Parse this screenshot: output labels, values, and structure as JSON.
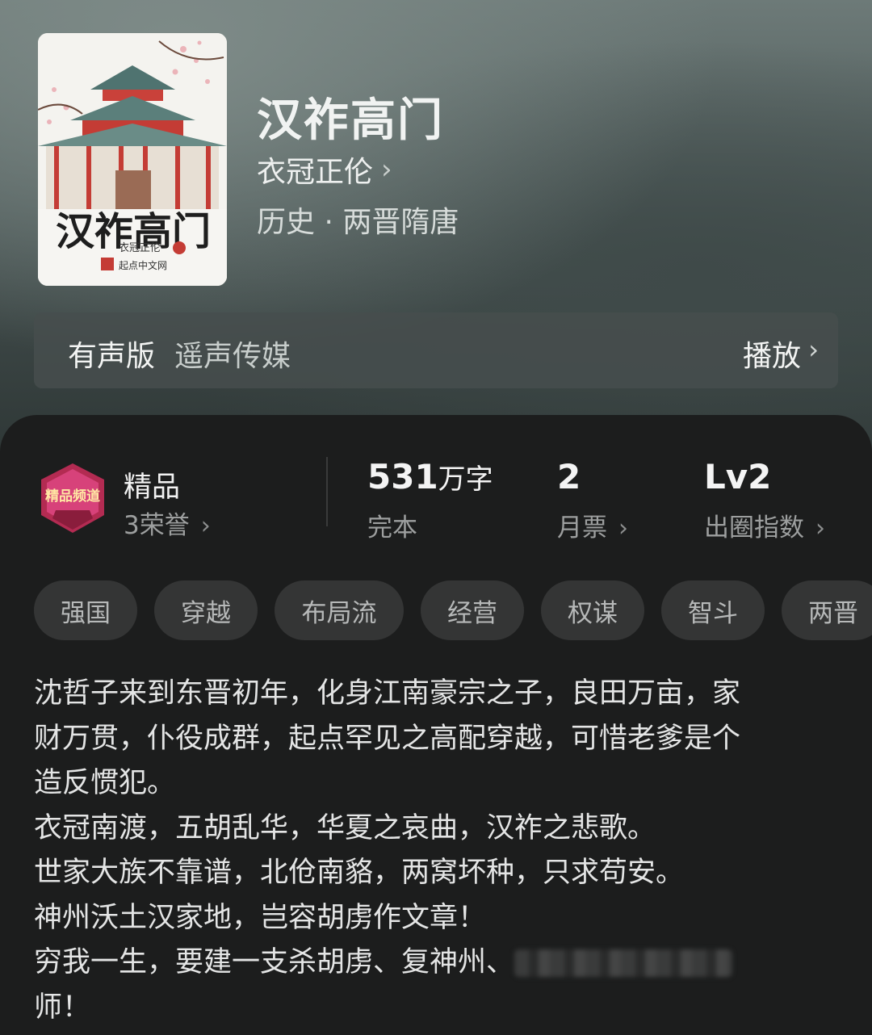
{
  "book": {
    "title": "汉祚高门",
    "author": "衣冠正伦",
    "genre": "历史 · 两晋隋唐",
    "cover_title": "汉祚高门",
    "cover_author": "衣冠正伦",
    "cover_publisher": "起点中文网"
  },
  "audio": {
    "label": "有声版",
    "publisher": "遥声传媒",
    "play_label": "播放"
  },
  "stats": {
    "badge_text": "精品频道",
    "quality_label": "精品",
    "honors": "3荣誉",
    "word_count": "531",
    "word_unit": "万字",
    "status": "完本",
    "monthly_votes": "2",
    "monthly_votes_label": "月票",
    "level": "Lv2",
    "level_label": "出圈指数"
  },
  "tags": [
    "强国",
    "穿越",
    "布局流",
    "经营",
    "权谋",
    "智斗",
    "两晋"
  ],
  "synopsis": [
    "沈哲子来到东晋初年，化身江南豪宗之子，良田万亩，家",
    "财万贯，仆役成群，起点罕见之高配穿越，可惜老爹是个",
    "造反惯犯。",
    "衣冠南渡，五胡乱华，华夏之哀曲，汉祚之悲歌。",
    "世家大族不靠谱，北伧南貉，两窝坏种，只求苟安。",
    "神州沃土汉家地，岂容胡虏作文章！",
    "穷我一生，要建一支杀胡虏、复神州、",
    "师！"
  ]
}
